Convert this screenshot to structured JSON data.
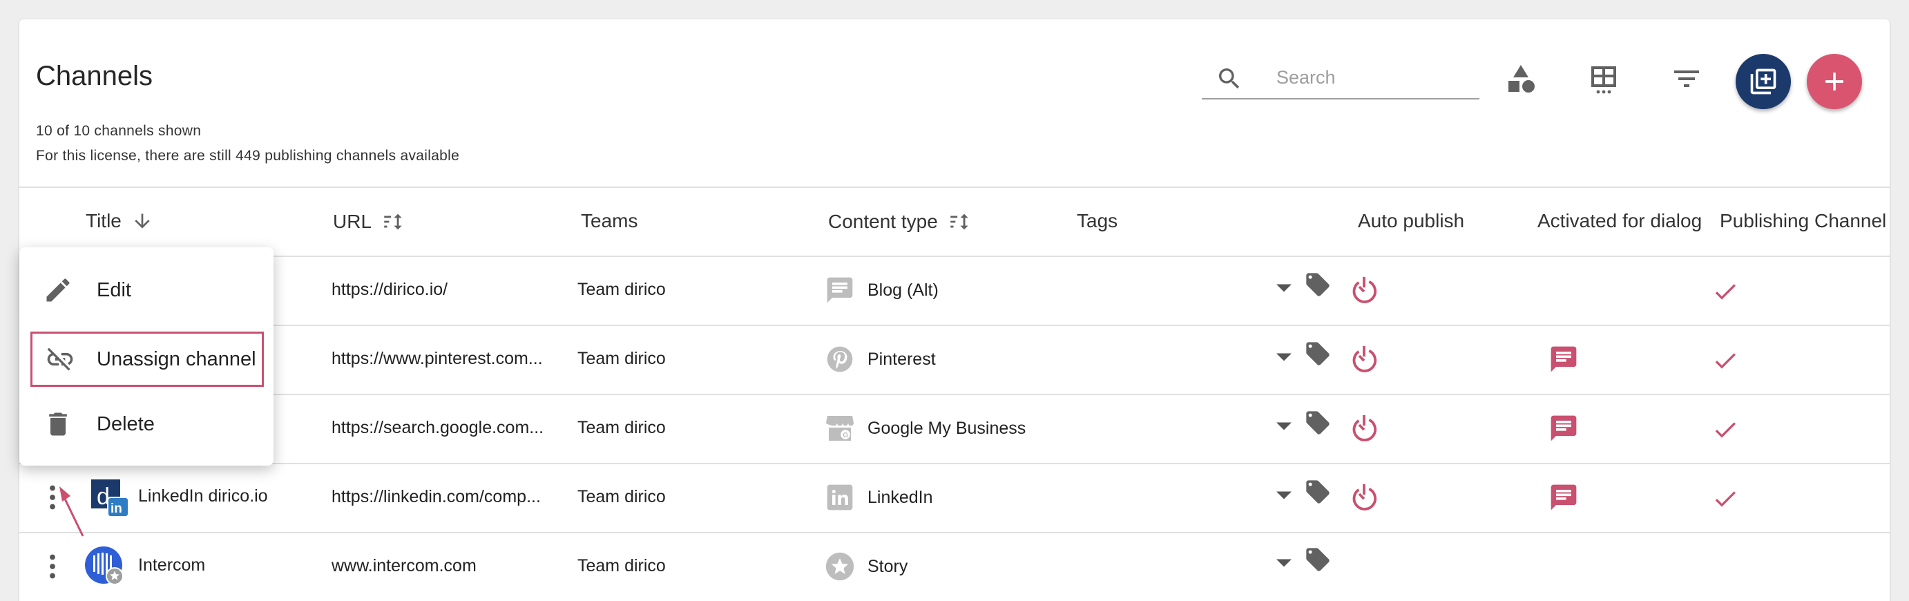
{
  "page": {
    "title": "Channels",
    "shown_count": "10 of 10 channels shown",
    "license_info": "For this license, there are still 449 publishing channels available"
  },
  "search": {
    "placeholder": "Search",
    "value": ""
  },
  "toolbar": {
    "icons": [
      "category-icon",
      "table-columns-icon",
      "filter-icon",
      "add-to-library-icon",
      "plus-icon"
    ],
    "accent_dark": "#1b3a6b",
    "accent_pink": "#d9546f"
  },
  "table": {
    "columns": [
      "Title",
      "URL",
      "Teams",
      "Content type",
      "Tags",
      "Auto publish",
      "Activated for dialog",
      "Publishing Channel"
    ],
    "rows": [
      {
        "title": "",
        "url": "https://dirico.io/",
        "team": "Team dirico",
        "content_type": "Blog (Alt)",
        "content_icon": "message-icon",
        "auto_publish": true,
        "dialog": false,
        "publishing": true
      },
      {
        "title": "",
        "url": "https://www.pinterest.com...",
        "team": "Team dirico",
        "content_type": "Pinterest",
        "content_icon": "pinterest-icon",
        "auto_publish": true,
        "dialog": true,
        "publishing": true
      },
      {
        "title": "",
        "url": "https://search.google.com...",
        "team": "Team dirico",
        "content_type": "Google My Business",
        "content_icon": "storefront-icon",
        "auto_publish": true,
        "dialog": true,
        "publishing": true
      },
      {
        "title": "LinkedIn dirico.io",
        "url": "https://linkedin.com/comp...",
        "team": "Team dirico",
        "content_type": "LinkedIn",
        "content_icon": "linkedin-icon",
        "auto_publish": true,
        "dialog": true,
        "publishing": true
      },
      {
        "title": "Intercom",
        "url": "www.intercom.com",
        "team": "Team dirico",
        "content_type": "Story",
        "content_icon": "star-icon",
        "auto_publish": false,
        "dialog": false,
        "publishing": false
      }
    ]
  },
  "context_menu": {
    "items": [
      {
        "label": "Edit",
        "icon": "pencil-icon"
      },
      {
        "label": "Unassign channel",
        "icon": "link-off-icon",
        "highlighted": true
      },
      {
        "label": "Delete",
        "icon": "trash-icon"
      }
    ]
  }
}
